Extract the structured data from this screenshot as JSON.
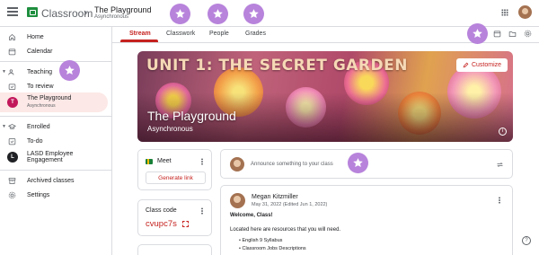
{
  "header": {
    "app_title": "Classroom",
    "class_name": "The Playground",
    "class_section": "Asynchronous"
  },
  "tabs": [
    "Stream",
    "Classwork",
    "People",
    "Grades"
  ],
  "sidebar": {
    "home": "Home",
    "calendar": "Calendar",
    "teaching": "Teaching",
    "to_review": "To review",
    "class_item": {
      "avatar": "T",
      "name": "The Playground",
      "sub": "Asynchronous"
    },
    "enrolled": "Enrolled",
    "todo": "To-do",
    "enrolled_class": {
      "avatar": "L",
      "name": "LASD Employee Engagement"
    },
    "archived": "Archived classes",
    "settings": "Settings"
  },
  "banner": {
    "unit_text": "UNIT 1: THE SECRET GARDEN",
    "title": "The Playground",
    "subtitle": "Asynchronous",
    "customize_label": "Customize"
  },
  "meet": {
    "label": "Meet",
    "button": "Generate link"
  },
  "class_code": {
    "label": "Class code",
    "value": "cvupc7s"
  },
  "announce": {
    "placeholder": "Announce something to your class"
  },
  "post": {
    "author": "Megan Kitzmiller",
    "date": "May 31, 2022 (Edited Jun 1, 2022)",
    "greeting": "Welcome, Class!",
    "intro": "Located here are resources that you will need.",
    "bullets": [
      "English 9 Syllabus",
      "Classroom Jobs Descriptions"
    ]
  },
  "colors": {
    "accent": "#c5221f",
    "badge": "#b783db",
    "selected_bg": "#fce8e6"
  }
}
